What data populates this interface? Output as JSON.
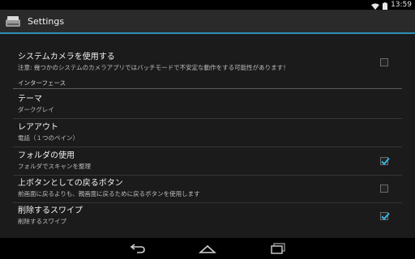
{
  "status_bar": {
    "time": "13:59"
  },
  "action_bar": {
    "title": "Settings"
  },
  "settings": {
    "system_camera": {
      "title": "システムカメラを使用する",
      "summary": "注意: 幾つかのシステムのカメラアプリではバッチモードで不安定な動作をする可能性があります！",
      "checked": false
    },
    "interface_header": "インターフェース",
    "theme": {
      "title": "テーマ",
      "summary": "ダークグレイ"
    },
    "layout": {
      "title": "レアアウト",
      "summary": "電話（１つのペイン）"
    },
    "folder": {
      "title": "フォルダの使用",
      "summary": "フォルダでスキャンを整理",
      "checked": true
    },
    "up_button": {
      "title": "上ボタンとしての戻るボタン",
      "summary": "前画面に戻るよりも、親画面に戻るために戻るボタンを使用します",
      "checked": false
    },
    "swipe_delete": {
      "title": "削除するスワイプ",
      "summary": "削除するスワイプ",
      "checked": true
    }
  },
  "icons": {
    "app": "scanner-icon",
    "wifi": "wifi-icon",
    "battery": "battery-icon",
    "back": "back-icon",
    "home": "home-icon",
    "recents": "recents-icon"
  },
  "colors": {
    "accent": "#2f8fb7",
    "check": "#33b5e5",
    "background": "#1b1b1b"
  }
}
